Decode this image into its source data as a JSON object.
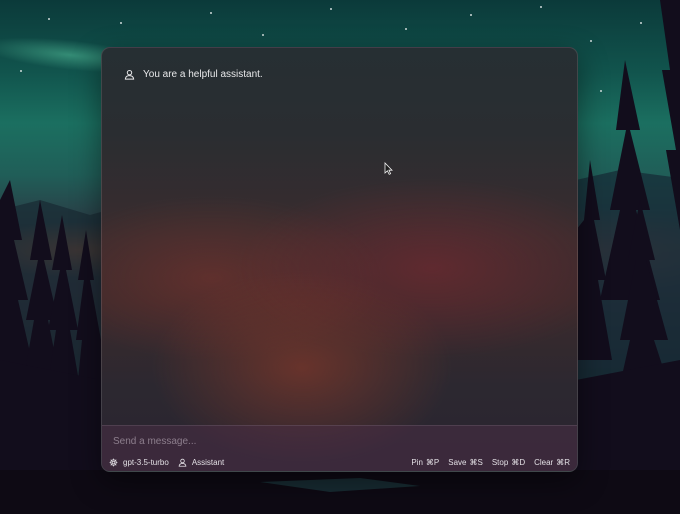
{
  "chat": {
    "system_prompt": "You are a helpful assistant.",
    "system_icon": "user-icon"
  },
  "composer": {
    "placeholder": "Send a message..."
  },
  "footer": {
    "model_label": "gpt-3.5-turbo",
    "model_icon": "gear-icon",
    "role_label": "Assistant",
    "role_icon": "user-icon",
    "shortcuts": [
      {
        "label": "Pin",
        "keys": "⌘P"
      },
      {
        "label": "Save",
        "keys": "⌘S"
      },
      {
        "label": "Stop",
        "keys": "⌘D"
      },
      {
        "label": "Clear",
        "keys": "⌘R"
      }
    ]
  },
  "colors": {
    "text": "#e8e8ea",
    "composer_bg": "#482e46",
    "window_border": "#3a3a40"
  }
}
